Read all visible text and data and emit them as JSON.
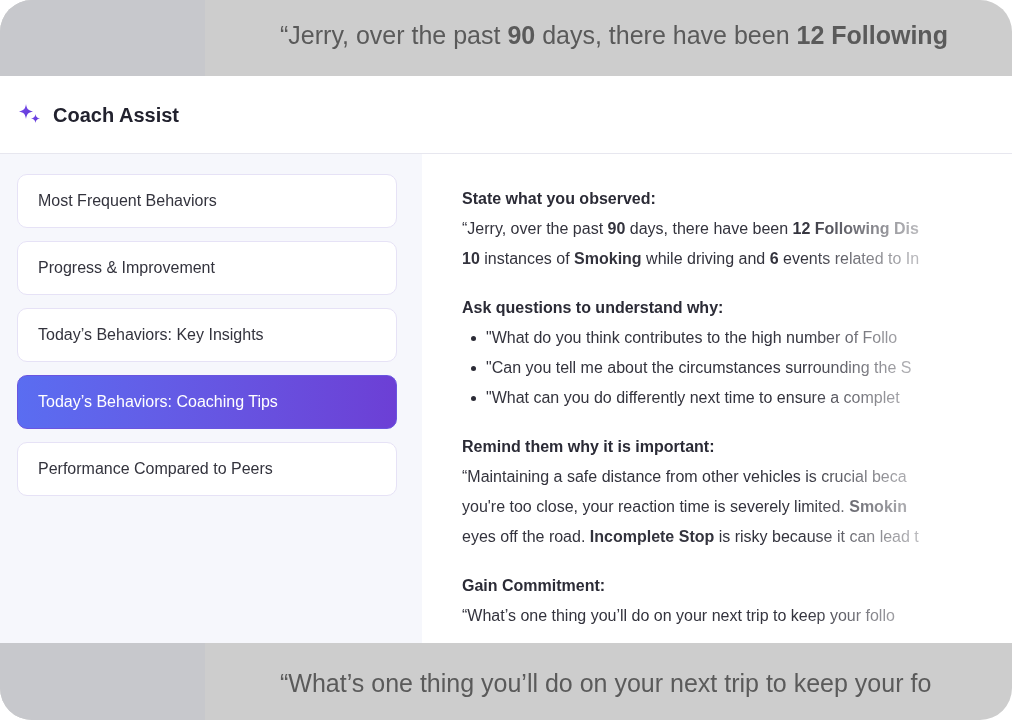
{
  "backdrop": {
    "top_line": "“Jerry, over the past **90** days, there have been **12 Following**",
    "bottom_line": "“What’s one thing you’ll do on your next trip to keep your fo"
  },
  "header": {
    "title": "Coach Assist"
  },
  "sidebar": {
    "items": [
      {
        "label": "Most Frequent Behaviors",
        "selected": false
      },
      {
        "label": "Progress & Improvement",
        "selected": false
      },
      {
        "label": "Today’s Behaviors: Key Insights",
        "selected": false
      },
      {
        "label": "Today’s Behaviors: Coaching Tips",
        "selected": true
      },
      {
        "label": "Performance Compared to Peers",
        "selected": false
      }
    ]
  },
  "content": {
    "sections": [
      {
        "heading": "State what you observed:",
        "kind": "paragraph",
        "lines": [
          "“Jerry, over the past **90** days, there have been **12 Following Dis**",
          "**10** instances of **Smoking** while driving and **6** events related to In"
        ]
      },
      {
        "heading": "Ask questions to understand why:",
        "kind": "bullets",
        "lines": [
          "\"What do you think contributes to the high number of Follo",
          "\"Can you tell me about the circumstances surrounding the S",
          "\"What can you do differently next time to ensure a complet"
        ]
      },
      {
        "heading": "Remind them why it is important:",
        "kind": "paragraph",
        "lines": [
          "“Maintaining a safe distance from other vehicles is crucial beca",
          "you're too close, your reaction time is severely limited. **Smokin**",
          "eyes off the road. **Incomplete Stop** is risky because it can lead t"
        ]
      },
      {
        "heading": "Gain Commitment:",
        "kind": "paragraph",
        "lines": [
          "“What’s one thing you’ll do on your next trip to keep your follo"
        ]
      }
    ]
  }
}
